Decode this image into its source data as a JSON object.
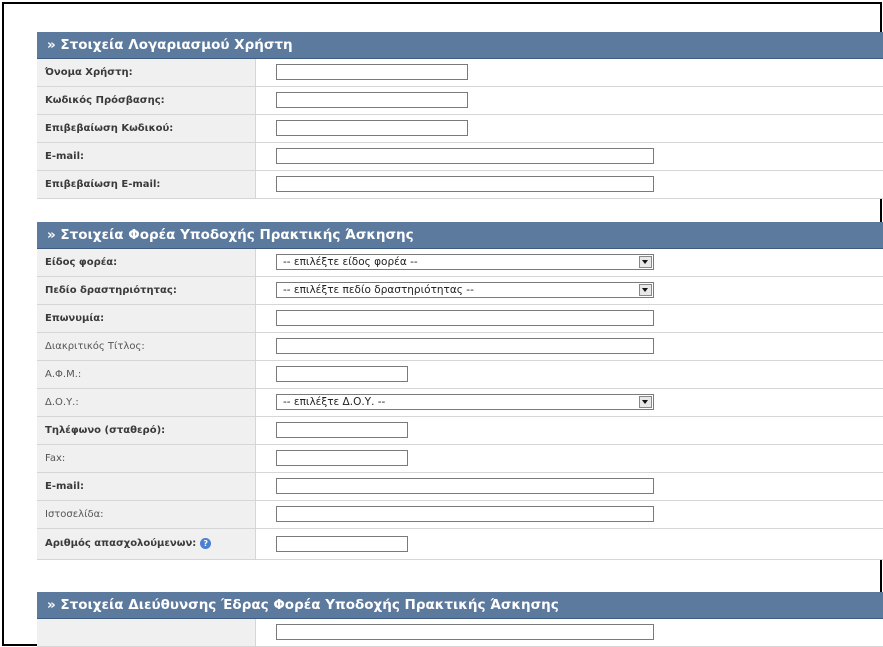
{
  "account": {
    "header": "» Στοιχεία Λογαριασμού Χρήστη",
    "rows": [
      {
        "label": "Όνομα Χρήστη:",
        "value": ""
      },
      {
        "label": "Κωδικός Πρόσβασης:",
        "value": ""
      },
      {
        "label": "Επιβεβαίωση Κωδικού:",
        "value": ""
      },
      {
        "label": "E-mail:",
        "value": ""
      },
      {
        "label": "Επιβεβαίωση E-mail:",
        "value": ""
      }
    ]
  },
  "host": {
    "header": "» Στοιχεία Φορέα Υποδοχής Πρακτικής Άσκησης",
    "rows": [
      {
        "label": "Είδος φορέα:",
        "value": "-- επιλέξτε είδος φορέα --"
      },
      {
        "label": "Πεδίο δραστηριότητας:",
        "value": "-- επιλέξτε πεδίο δραστηριότητας --"
      },
      {
        "label": "Επωνυμία:",
        "value": ""
      },
      {
        "label": "Διακριτικός Τίτλος:",
        "value": ""
      },
      {
        "label": "Α.Φ.Μ.:",
        "value": ""
      },
      {
        "label": "Δ.Ο.Υ.:",
        "value": "-- επιλέξτε Δ.Ο.Υ. --"
      },
      {
        "label": "Τηλέφωνο (σταθερό):",
        "value": ""
      },
      {
        "label": "Fax:",
        "value": ""
      },
      {
        "label": "E-mail:",
        "value": ""
      },
      {
        "label": "Ιστοσελίδα:",
        "value": ""
      },
      {
        "label": "Αριθμός απασχολούμενων:",
        "value": "",
        "help_icon": "help-icon"
      }
    ]
  },
  "address": {
    "header": "» Στοιχεία Διεύθυνσης Έδρας Φορέα Υποδοχής Πρακτικής Άσκησης"
  },
  "colors": {
    "header_bg": "#5b7a9e",
    "label_bg": "#f0f0f0",
    "border": "#d6d6d6"
  }
}
